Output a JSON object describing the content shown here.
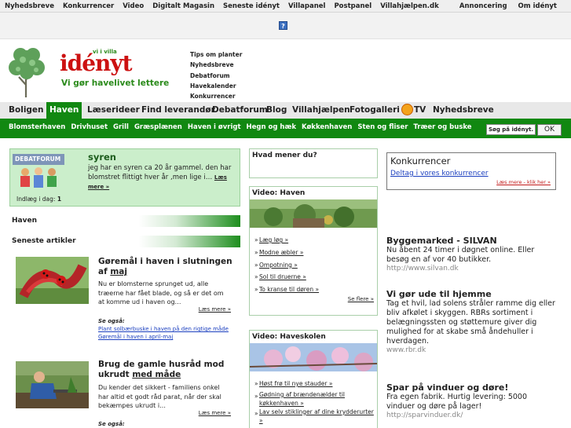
{
  "topbar": {
    "left": [
      "Nyhedsbreve",
      "Konkurrencer",
      "Video",
      "Digitalt Magasin",
      "Seneste idényt",
      "Villapanel",
      "Postpanel",
      "Villahjælpen.dk"
    ],
    "right": [
      "Annoncering",
      "Om idényt"
    ]
  },
  "help_icon": "?",
  "logo": {
    "tagline_top": "vi i villa",
    "name": "idényt",
    "slogan": "Vi gør havelivet lettere"
  },
  "quick_links": [
    "Tips om planter",
    "Nyhedsbreve",
    "Debatforum",
    "Havekalender",
    "Konkurrencer"
  ],
  "main_nav": [
    "Boligen",
    "Haven",
    "Læserideer",
    "Find leverandør",
    "Debatforum",
    "Blog",
    "Villahjælpen",
    "Fotogalleri",
    "TV",
    "Nyhedsbreve"
  ],
  "sub_nav": [
    "Blomsterhaven",
    "Drivhuset",
    "Grill",
    "Græsplænen",
    "Haven i øvrigt",
    "Hegn og hæk",
    "Køkkenhaven",
    "Sten og fliser",
    "Træer og buske"
  ],
  "search": {
    "value": "Søg på idényt.dk",
    "button": "OK"
  },
  "debat": {
    "logo_text": "DEBATFORUM",
    "title": "syren",
    "text": "jeg har en syren ca 20 år gammel. den har blomstret flittigt hver år ,men lige i…",
    "more": "Læs mere »",
    "count_label": "Indlæg i dag:",
    "count": "1"
  },
  "sections": {
    "haven": "Haven",
    "latest": "Seneste artikler"
  },
  "articles": [
    {
      "title_a": "Gøremål i haven i slutningen af ",
      "title_b": "maj",
      "text": "Nu er blomsterne sprunget ud, alle træerne har fået blade, og så er det om at komme ud i haven og…",
      "more": "Læs mere »",
      "see_also": "Se også:",
      "links": [
        "Plant solbærbuske i haven på den rigtige måde",
        "Gøremål i haven i april-maj"
      ]
    },
    {
      "title_a": "Brug de gamle husråd mod ukrudt ",
      "title_b": "med måde",
      "text": "Du kender det sikkert - familiens onkel har altid et godt råd parat, når der skal bekæmpes ukrudt i…",
      "more": "Læs mere »",
      "see_also": "Se også:"
    }
  ],
  "mid": {
    "opinion": "Hvad mener du?",
    "video_haven": {
      "title": "Video: Haven",
      "items": [
        "Læg løg »",
        "Modne æbler »",
        "Ompotning »",
        "Sol til druerne »",
        "To kranse til døren »"
      ],
      "more": "Se flere »"
    },
    "video_haveskolen": {
      "title": "Video: Haveskolen",
      "items": [
        "Høst frø til nye stauder »",
        "Gødning af brændenælder til køkkenhaven »",
        "Lav selv stiklinger af dine krydderurter »"
      ]
    }
  },
  "right": {
    "konkurrencer": {
      "title": "Konkurrencer",
      "link": "Deltag i vores konkurrencer",
      "more": "Læs mere - klik her »"
    },
    "ads": [
      {
        "title": "Byggemarked - SILVAN",
        "body": "Nu åbent 24 timer i døgnet online. Eller besøg en af vor 40 butikker.",
        "url": "http://www.silvan.dk"
      },
      {
        "title": "Vi gør ude til hjemme",
        "body": "Tag et hvil, lad solens stråler ramme dig eller bliv afkølet i skyggen. RBRs sortiment i belægningssten og støttemure giver dig mulighed for at skabe små åndehuller i hverdagen.",
        "url": "www.rbr.dk"
      },
      {
        "title": "Spar på vinduer og døre!",
        "body": "Fra egen fabrik. Hurtig levering: 5000 vinduer og døre på lager!",
        "url": "http://sparvinduer.dk/"
      }
    ]
  },
  "colors": {
    "green": "#118811",
    "red": "#cc1111",
    "link_blue": "#1b3fbf",
    "panel_green": "#cbeecb"
  }
}
